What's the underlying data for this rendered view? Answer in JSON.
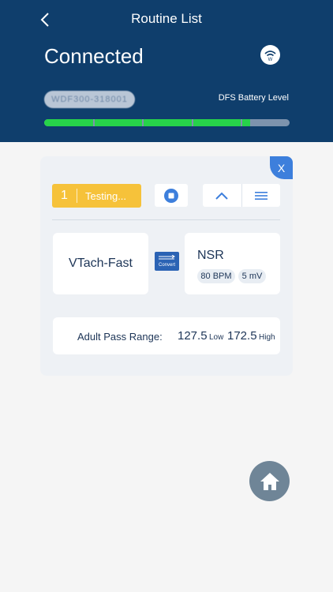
{
  "header": {
    "title": "Routine List",
    "connection_status": "Connected",
    "device_id": "WDF300-318001",
    "battery_label": "DFS Battery Level",
    "battery_level": 0.82
  },
  "routine": {
    "step_number": "1",
    "step_status": "Testing...",
    "close_label": "X",
    "from_rhythm": "VTach-Fast",
    "convert_label": "Convert",
    "to_rhythm": "NSR",
    "rate": "80 BPM",
    "amplitude": "5 mV",
    "pass_range_label": "Adult Pass Range:",
    "low_value": "127.5",
    "low_label": "Low",
    "high_value": "172.5",
    "high_label": "High"
  },
  "colors": {
    "header_bg": "#0f3e6c",
    "battery_fill": "#27d34a",
    "testing_bg": "#f6c23a",
    "accent_blue": "#3d7fdc"
  }
}
